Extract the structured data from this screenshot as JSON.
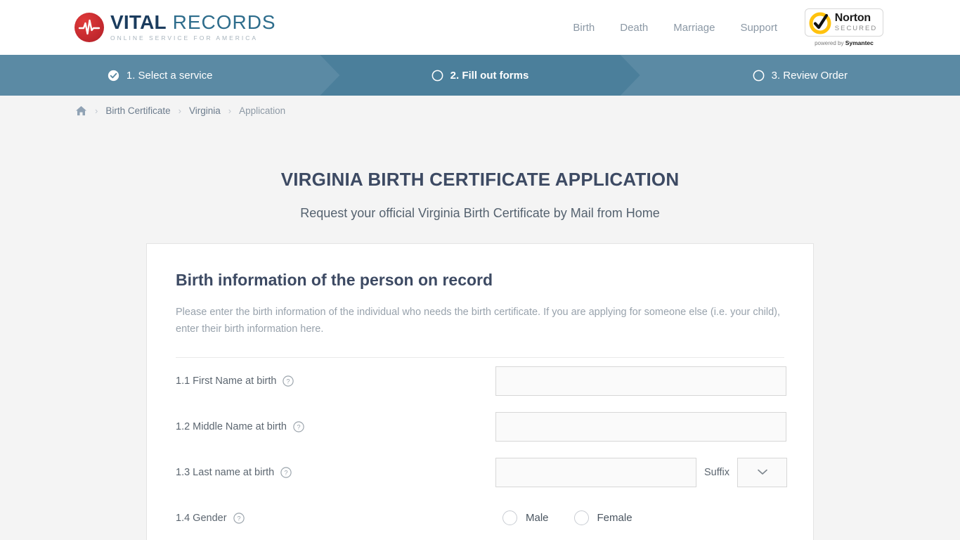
{
  "header": {
    "logo": {
      "icon": "pulse-circle-icon",
      "name_bold": "VITAL",
      "name_light": " RECORDS",
      "tagline": "ONLINE SERVICE FOR AMERICA"
    },
    "nav": [
      {
        "label": "Birth"
      },
      {
        "label": "Death"
      },
      {
        "label": "Marriage"
      },
      {
        "label": "Support"
      }
    ],
    "norton": {
      "name": "Norton",
      "secured": "SECURED",
      "powered_prefix": "powered by ",
      "powered_brand": "Symantec"
    }
  },
  "steps": [
    {
      "label": "1. Select a service",
      "state": "complete",
      "icon": "check-circle-icon"
    },
    {
      "label": "2. Fill out forms",
      "state": "active",
      "icon": "empty-circle-icon"
    },
    {
      "label": "3. Review Order",
      "state": "upcoming",
      "icon": "empty-circle-icon"
    }
  ],
  "breadcrumb": {
    "home_icon": "home-icon",
    "separator": "›",
    "items": [
      {
        "label": "Birth Certificate"
      },
      {
        "label": "Virginia"
      },
      {
        "label": "Application"
      }
    ]
  },
  "page": {
    "title": "VIRGINIA BIRTH CERTIFICATE APPLICATION",
    "subtitle": "Request your official Virginia Birth Certificate by Mail from Home"
  },
  "form": {
    "section_title": "Birth information of the person on record",
    "section_desc": "Please enter the birth information of the individual who needs the birth certificate. If you are applying for someone else (i.e. your child), enter their birth information here.",
    "fields": {
      "first_name": {
        "label": "1.1 First Name at birth",
        "value": "",
        "help_icon": "question-circle-icon"
      },
      "middle_name": {
        "label": "1.2 Middle Name at birth",
        "value": "",
        "help_icon": "question-circle-icon"
      },
      "last_name": {
        "label": "1.3 Last name at birth",
        "value": "",
        "help_icon": "question-circle-icon"
      },
      "suffix": {
        "label": "Suffix",
        "value": "",
        "icon": "chevron-down-icon"
      },
      "gender": {
        "label": "1.4 Gender",
        "help_icon": "question-circle-icon",
        "options": [
          {
            "label": "Male",
            "selected": false
          },
          {
            "label": "Female",
            "selected": false
          }
        ]
      }
    }
  },
  "colors": {
    "step_bar": "#5b8aa4",
    "step_active": "#4b7f9b",
    "brand_red": "#c0272d",
    "brand_navy": "#1b3c5e",
    "heading": "#3d4a63",
    "norton_gold": "#ffc20e"
  }
}
